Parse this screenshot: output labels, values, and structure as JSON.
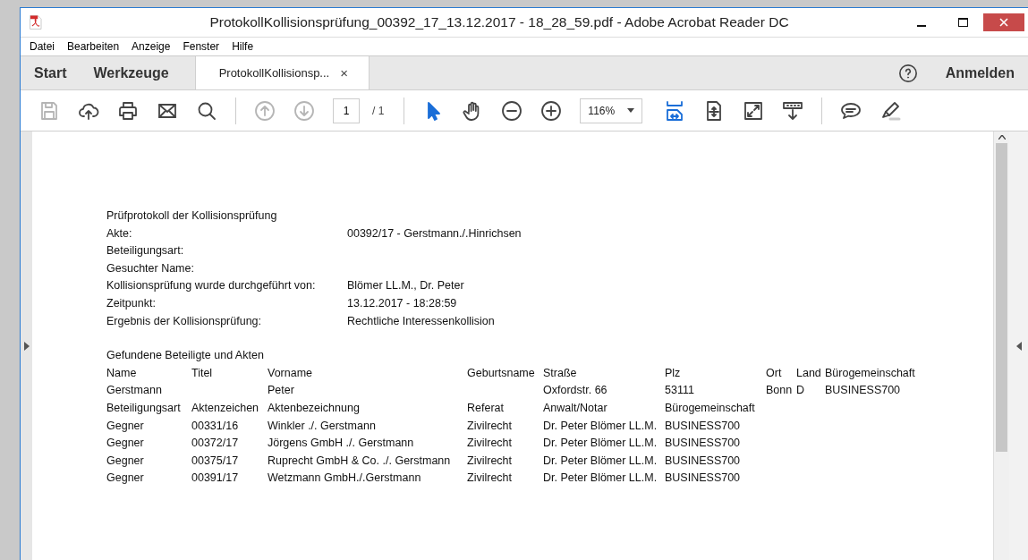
{
  "window": {
    "title": "ProtokollKollisionsprüfung_00392_17_13.12.2017 - 18_28_59.pdf - Adobe Acrobat Reader DC"
  },
  "menu": [
    "Datei",
    "Bearbeiten",
    "Anzeige",
    "Fenster",
    "Hilfe"
  ],
  "nav_tabs": [
    {
      "label": "Start",
      "selected": false
    },
    {
      "label": "Werkzeuge",
      "selected": false
    }
  ],
  "document_tab": {
    "label": "ProtokollKollisionsp...",
    "close": "×",
    "selected": true
  },
  "account": {
    "label": "Anmelden"
  },
  "toolbar": [
    {
      "kind": "save",
      "disabled": true,
      "selected": false
    },
    {
      "kind": "upload",
      "disabled": false,
      "selected": false
    },
    {
      "kind": "print",
      "disabled": false,
      "selected": false
    },
    {
      "kind": "mail",
      "disabled": false,
      "selected": false
    },
    {
      "kind": "search",
      "disabled": false,
      "selected": false
    },
    {
      "kind": "separator"
    },
    {
      "kind": "prevpage",
      "disabled": true,
      "selected": false
    },
    {
      "kind": "nextpage",
      "disabled": true,
      "selected": false
    },
    {
      "kind": "pagefield",
      "value": "1",
      "total": "/ 1"
    },
    {
      "kind": "separator"
    },
    {
      "kind": "pointer",
      "disabled": false,
      "selected": true
    },
    {
      "kind": "hand",
      "disabled": false,
      "selected": false
    },
    {
      "kind": "zoomout",
      "disabled": false,
      "selected": false
    },
    {
      "kind": "zoomin",
      "disabled": false,
      "selected": false
    },
    {
      "kind": "zoomfield",
      "value": "116%"
    },
    {
      "kind": "fitwidth",
      "disabled": false,
      "selected": true
    },
    {
      "kind": "fitpage",
      "disabled": false,
      "selected": false
    },
    {
      "kind": "fullscreen",
      "disabled": false,
      "selected": false
    },
    {
      "kind": "readmode",
      "disabled": false,
      "selected": false
    },
    {
      "kind": "separator"
    },
    {
      "kind": "comment",
      "disabled": false,
      "selected": false
    },
    {
      "kind": "highlight",
      "disabled": false,
      "selected": false
    }
  ],
  "document": {
    "title": "Prüfprotokoll der Kollisionsprüfung",
    "fields": [
      {
        "label": "Akte:",
        "value": "00392/17 - Gerstmann./.Hinrichsen"
      },
      {
        "label": "Beteiligungsart:"
      },
      {
        "label": "Gesuchter Name:"
      },
      {
        "label": "Kollisionsprüfung wurde durchgeführt von:",
        "value": "Blömer LL.M., Dr. Peter"
      },
      {
        "label": "Zeitpunkt:",
        "value": "13.12.2017 - 18:28:59"
      },
      {
        "label": "Ergebnis der Kollisionsprüfung:",
        "value": "Rechtliche Interessenkollision"
      }
    ],
    "section_title": "Gefundene Beteiligte und Akten",
    "persons": {
      "columns": [
        "Name",
        "Titel",
        "Vorname",
        "Geburtsname",
        "Straße",
        "Plz",
        "Ort",
        "Land",
        "Bürogemeinschaft"
      ],
      "rows": [
        {
          "name": "Gerstmann",
          "vorname": "Peter",
          "strasse": "Oxfordstr. 66",
          "plz": "53111",
          "ort": "Bonn",
          "land": "D",
          "buerogemeinschaft": "BUSINESS700"
        }
      ]
    },
    "files": {
      "columns": [
        "Beteiligungsart",
        "Aktenzeichen",
        "Aktenbezeichnung",
        "Referat",
        "Anwalt/Notar",
        "Bürogemeinschaft"
      ],
      "rows": [
        [
          "Gegner",
          "00331/16",
          "Winkler ./. Gerstmann",
          "Zivilrecht",
          "Dr. Peter Blömer LL.M.",
          "BUSINESS700"
        ],
        [
          "Gegner",
          "00372/17",
          "Jörgens GmbH ./. Gerstmann",
          "Zivilrecht",
          "Dr. Peter Blömer LL.M.",
          "BUSINESS700"
        ],
        [
          "Gegner",
          "00375/17",
          "Ruprecht GmbH & Co. ./. Gerstmann",
          "Zivilrecht",
          "Dr. Peter Blömer LL.M.",
          "BUSINESS700"
        ],
        [
          "Gegner",
          "00391/17",
          "Wetzmann GmbH./.Gerstmann",
          "Zivilrecht",
          "Dr. Peter Blömer LL.M.",
          "BUSINESS700"
        ]
      ]
    }
  }
}
